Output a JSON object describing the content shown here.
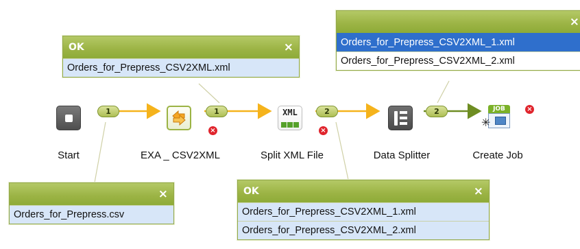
{
  "colors": {
    "panel_header": "#9bb344",
    "selected_row": "#2f6fcc",
    "highlight_row": "#d7e6f8",
    "flow_arrow": "#f5b31c",
    "flow_arrow_done": "#6e8d22",
    "error": "#e0252d"
  },
  "icons": {
    "start": "stop-square-icon",
    "exa": "exchange-arrows-icon",
    "split": "xml-split-icon",
    "splitter": "data-splitter-icon",
    "job": "job-folder-icon",
    "error": "error-x-icon",
    "close": "close-icon"
  },
  "nodes": {
    "start": {
      "label": "Start"
    },
    "exa": {
      "label": "EXA _ CSV2XML"
    },
    "split": {
      "label": "Split XML File",
      "icon_text": "XML"
    },
    "splitter": {
      "label": "Data Splitter"
    },
    "job": {
      "label": "Create Job",
      "icon_text": "JOB"
    }
  },
  "badges": {
    "start_to_exa": "1",
    "exa_to_split": "1",
    "split_to_splitter": "2",
    "splitter_to_job": "2"
  },
  "panels": {
    "top_left": {
      "title": "OK",
      "close": "×",
      "rows": [
        "Orders_for_Prepress_CSV2XML.xml"
      ]
    },
    "top_right": {
      "title": "",
      "close": "×",
      "rows": [
        "Orders_for_Prepress_CSV2XML_1.xml",
        "Orders_for_Prepress_CSV2XML_2.xml"
      ]
    },
    "bottom_left": {
      "title": "",
      "close": "×",
      "rows": [
        "Orders_for_Prepress.csv"
      ]
    },
    "bottom_middle": {
      "title": "OK",
      "close": "×",
      "rows": [
        "Orders_for_Prepress_CSV2XML_1.xml",
        "Orders_for_Prepress_CSV2XML_2.xml"
      ]
    }
  }
}
